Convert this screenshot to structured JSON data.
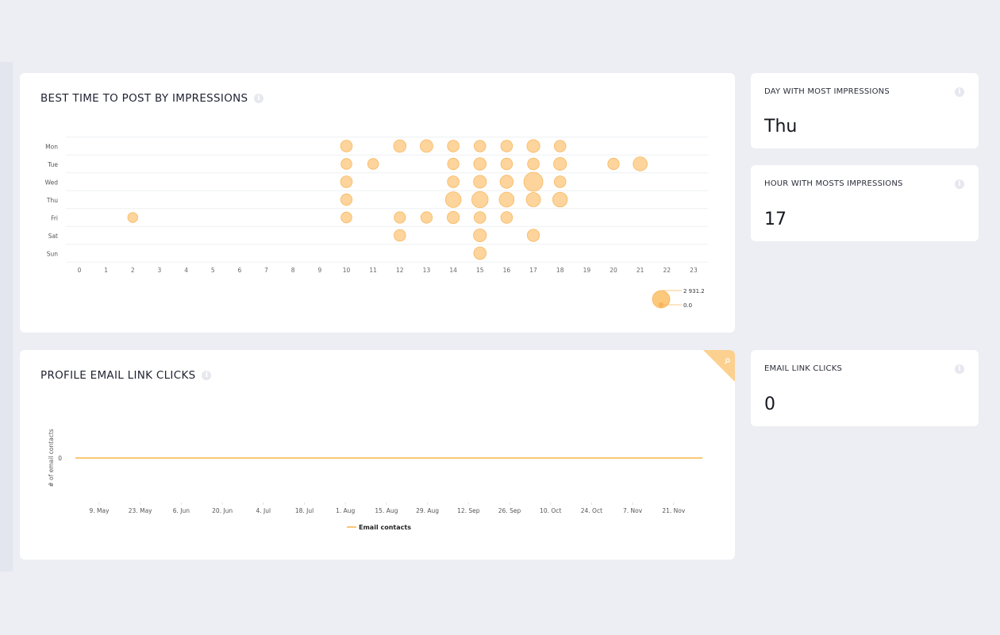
{
  "panels": {
    "best_time": {
      "title": "BEST TIME TO POST BY IMPRESSIONS",
      "info_icon": "info-icon"
    },
    "email_clicks": {
      "title": "PROFILE EMAIL LINK CLICKS",
      "info_icon": "info-icon",
      "corner_icon": "search-icon"
    }
  },
  "stats": [
    {
      "label": "DAY WITH MOST IMPRESSIONS",
      "value": "Thu"
    },
    {
      "label": "HOUR WITH MOSTS IMPRESSIONS",
      "value": "17"
    },
    {
      "label": "EMAIL LINK CLICKS",
      "value": "0"
    }
  ],
  "colors": {
    "bubble_fill": "#fdd49b",
    "bubble_stroke": "#f6b860",
    "line": "#f7b548"
  },
  "chart_data": [
    {
      "type": "scatter",
      "title": "BEST TIME TO POST BY IMPRESSIONS",
      "x_categories": [
        "0",
        "1",
        "2",
        "3",
        "4",
        "5",
        "6",
        "7",
        "8",
        "9",
        "10",
        "11",
        "12",
        "13",
        "14",
        "15",
        "16",
        "17",
        "18",
        "19",
        "20",
        "21",
        "22",
        "23"
      ],
      "y_categories": [
        "Mon",
        "Tue",
        "Wed",
        "Thu",
        "Fri",
        "Sat",
        "Sun"
      ],
      "size_legend": {
        "max": "2 931.2",
        "min": "0.0"
      },
      "points": [
        {
          "day": "Mon",
          "hour": 10,
          "value": 1100
        },
        {
          "day": "Mon",
          "hour": 12,
          "value": 1250
        },
        {
          "day": "Mon",
          "hour": 13,
          "value": 1300
        },
        {
          "day": "Mon",
          "hour": 14,
          "value": 1100
        },
        {
          "day": "Mon",
          "hour": 15,
          "value": 1100
        },
        {
          "day": "Mon",
          "hour": 16,
          "value": 1100
        },
        {
          "day": "Mon",
          "hour": 17,
          "value": 1350
        },
        {
          "day": "Mon",
          "hour": 18,
          "value": 1100
        },
        {
          "day": "Tue",
          "hour": 10,
          "value": 950
        },
        {
          "day": "Tue",
          "hour": 11,
          "value": 950
        },
        {
          "day": "Tue",
          "hour": 14,
          "value": 1050
        },
        {
          "day": "Tue",
          "hour": 15,
          "value": 1250
        },
        {
          "day": "Tue",
          "hour": 16,
          "value": 1100
        },
        {
          "day": "Tue",
          "hour": 17,
          "value": 1100
        },
        {
          "day": "Tue",
          "hour": 18,
          "value": 1350
        },
        {
          "day": "Tue",
          "hour": 20,
          "value": 1050
        },
        {
          "day": "Tue",
          "hour": 21,
          "value": 1600
        },
        {
          "day": "Wed",
          "hour": 10,
          "value": 1100
        },
        {
          "day": "Wed",
          "hour": 14,
          "value": 1100
        },
        {
          "day": "Wed",
          "hour": 15,
          "value": 1350
        },
        {
          "day": "Wed",
          "hour": 16,
          "value": 1400
        },
        {
          "day": "Wed",
          "hour": 17,
          "value": 2931.2
        },
        {
          "day": "Wed",
          "hour": 18,
          "value": 1100
        },
        {
          "day": "Thu",
          "hour": 10,
          "value": 1050
        },
        {
          "day": "Thu",
          "hour": 14,
          "value": 2000
        },
        {
          "day": "Thu",
          "hour": 15,
          "value": 2150
        },
        {
          "day": "Thu",
          "hour": 16,
          "value": 1800
        },
        {
          "day": "Thu",
          "hour": 17,
          "value": 1650
        },
        {
          "day": "Thu",
          "hour": 18,
          "value": 1750
        },
        {
          "day": "Fri",
          "hour": 2,
          "value": 800
        },
        {
          "day": "Fri",
          "hour": 10,
          "value": 950
        },
        {
          "day": "Fri",
          "hour": 12,
          "value": 1050
        },
        {
          "day": "Fri",
          "hour": 13,
          "value": 1050
        },
        {
          "day": "Fri",
          "hour": 14,
          "value": 1200
        },
        {
          "day": "Fri",
          "hour": 15,
          "value": 1100
        },
        {
          "day": "Fri",
          "hour": 16,
          "value": 1100
        },
        {
          "day": "Sat",
          "hour": 12,
          "value": 1100
        },
        {
          "day": "Sat",
          "hour": 15,
          "value": 1350
        },
        {
          "day": "Sat",
          "hour": 17,
          "value": 1200
        },
        {
          "day": "Sun",
          "hour": 15,
          "value": 1250
        }
      ],
      "grid": true
    },
    {
      "type": "line",
      "title": "PROFILE EMAIL LINK CLICKS",
      "ylabel": "# of email contacts",
      "y_ticks": [
        "0"
      ],
      "x_ticks": [
        "9. May",
        "23. May",
        "6. Jun",
        "20. Jun",
        "4. Jul",
        "18. Jul",
        "1. Aug",
        "15. Aug",
        "29. Aug",
        "12. Sep",
        "26. Sep",
        "10. Oct",
        "24. Oct",
        "7. Nov",
        "21. Nov"
      ],
      "series": [
        {
          "name": "Email contacts",
          "values_constant": 0
        }
      ],
      "legend": "bottom-center"
    }
  ]
}
